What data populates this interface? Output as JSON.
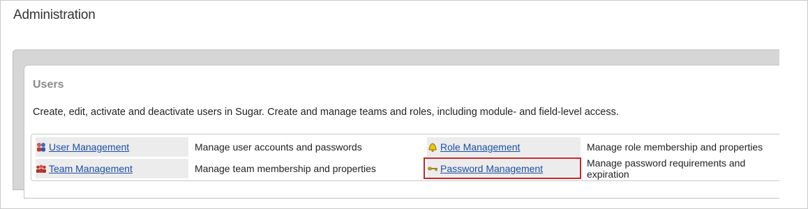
{
  "page": {
    "title": "Administration"
  },
  "users_section": {
    "title": "Users",
    "description": "Create, edit, activate and deactivate users in Sugar. Create and manage teams and roles, including module- and field-level access.",
    "rows": [
      {
        "left_link": "User Management",
        "left_icon": "users-icon",
        "left_desc": "Manage user accounts and passwords",
        "right_link": "Role Management",
        "right_icon": "bell-icon",
        "right_desc": "Manage role membership and properties"
      },
      {
        "left_link": "Team Management",
        "left_icon": "team-icon",
        "left_desc": "Manage team membership and properties",
        "right_link": "Password Management",
        "right_icon": "key-icon",
        "right_desc": "Manage password requirements and expiration"
      }
    ]
  },
  "colors": {
    "link": "#1a4fa3",
    "highlight_border": "#c62828",
    "panel_gray": "#d6d6d6",
    "cell_gray": "#ececec"
  }
}
